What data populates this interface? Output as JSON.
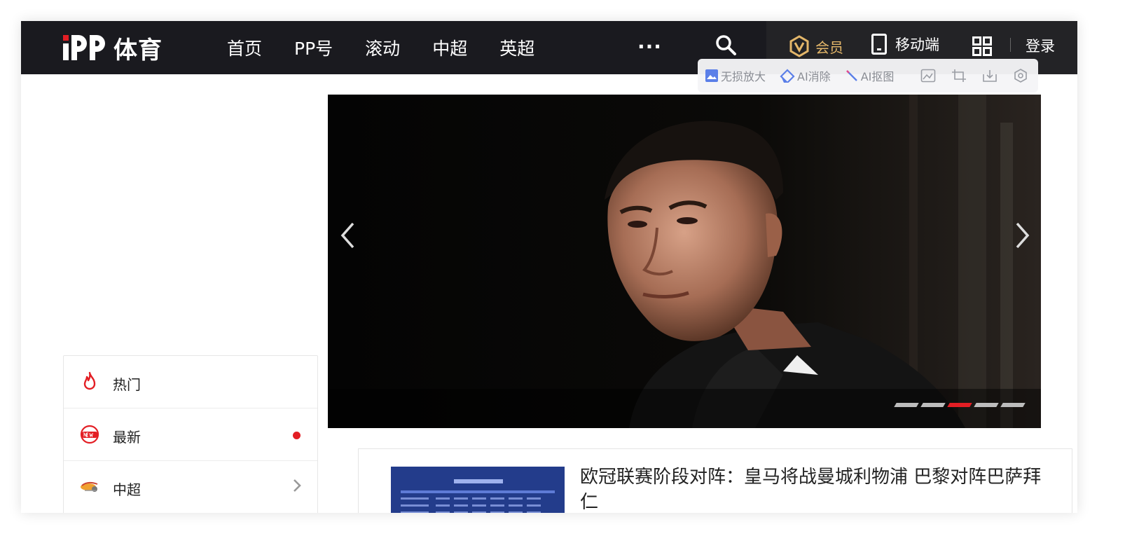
{
  "brand": {
    "logo_text": "体育"
  },
  "nav": {
    "items": [
      "首页",
      "PP号",
      "滚动",
      "中超",
      "英超"
    ],
    "more_label": "···"
  },
  "header_right": {
    "vip_label": "会员",
    "mobile_label": "移动端",
    "login_label": "登录"
  },
  "image_tools": {
    "upscale": "无损放大",
    "erase": "AI消除",
    "matting": "AI抠图"
  },
  "sidebar": {
    "items": [
      {
        "label": "热门",
        "icon": "fire-icon"
      },
      {
        "label": "最新",
        "icon": "new-badge-icon"
      },
      {
        "label": "中超",
        "icon": "csl-logo-icon"
      }
    ]
  },
  "carousel": {
    "slide_count": 5,
    "active_index": 2
  },
  "news": {
    "title": "欧冠联赛阶段对阵：皇马将战曼城利物浦 巴黎对阵巴萨拜仁"
  },
  "colors": {
    "accent": "#e31e24",
    "vip_gold": "#e4b76a",
    "nav_bg": "#1a1a1f"
  }
}
